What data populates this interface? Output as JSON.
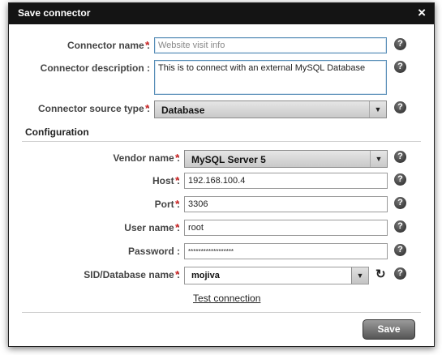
{
  "dialog": {
    "title": "Save connector",
    "close_glyph": "×"
  },
  "fields": {
    "connector_name": {
      "label": "Connector name :",
      "required": "*",
      "placeholder": "Website visit info"
    },
    "connector_description": {
      "label": "Connector description :",
      "value": "This is to connect with an external MySQL Database"
    },
    "source_type": {
      "label": "Connector source type :",
      "required": "*",
      "value": "Database",
      "arrow": "▼"
    }
  },
  "configuration": {
    "title": "Configuration",
    "vendor": {
      "label": "Vendor name :",
      "required": "*",
      "value": "MySQL Server 5",
      "arrow": "▼"
    },
    "host": {
      "label": "Host :",
      "required": "*",
      "value": "192.168.100.4"
    },
    "port": {
      "label": "Port :",
      "required": "*",
      "value": "3306"
    },
    "username": {
      "label": "User name :",
      "required": "*",
      "value": "root"
    },
    "password": {
      "label": "Password :",
      "value": "******************"
    },
    "sid": {
      "label": "SID/Database name :",
      "required": "*",
      "value": "mojiva",
      "arrow": "▼"
    },
    "refresh_glyph": "↻",
    "test_connection": "Test connection"
  },
  "help_glyph": "?",
  "footer": {
    "save_label": "Save"
  },
  "icons": {
    "help": "help-icon",
    "close": "close-icon",
    "refresh": "refresh-icon",
    "dropdown": "chevron-down-icon"
  }
}
